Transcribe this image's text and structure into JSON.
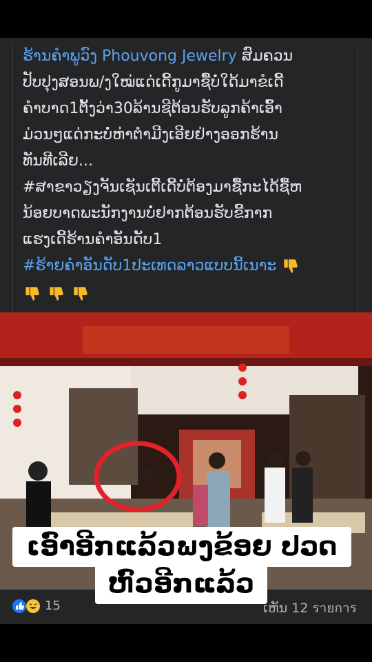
{
  "post": {
    "store_name": "ຮ້ານຄຳພູວົງ Phouvong Jewelry",
    "line1_rest": "ສົມຄວນ",
    "lines": [
      "ປັບປຸງສອນພ/ງໃໝ່ແດ່ເດີ້ກູມາຊື້ບໍ່ໃດ້ມາຂໍເດີ້",
      "ຄຳບາດ1ຕັ້ງວ່າ30ລ້ານຊີຕ້ອນຮັບລູກຄ້າເອົ້າ",
      "ມ່ວນໆແດ່ກະບໍ່ຫ່າຕຳມີງເອີຍຢ່າງອອກຮ້ານ",
      "ທັນທີເລີຍ...",
      "#ສາຂາວຽງຈັນເຊັນເຕີ້ເດີ້ບໍ່ຕ້ອງມາຊື້ກະໄດ້ຊື້ຫ",
      "ນ້ອຍບາດພະນັກງານບໍ່ຢາກຕ້ອນຮັບຂີ້ກາກ",
      "ແຮງເດີ້ຮ້ານຄຳອັນດັບ1"
    ],
    "hashtag": "#ຮ້າຍຄຳອັນດັບ1ປະເທດລາວແບບນີ້ເນາະ",
    "emoji_name": "thumbs-down"
  },
  "photo": {
    "overlay_line1": "ເອົາອີກແລ້ວພງຂ້ອຍ ປວດ",
    "overlay_line2": "ຫົວອີກແລ້ວ"
  },
  "footer": {
    "reaction_count": "15",
    "views": "ເຫັນ 12 รายการ",
    "reaction_icons": [
      "like-icon",
      "haha-icon"
    ],
    "like_color": "#1877f2",
    "haha_color": "#f7c33c"
  }
}
